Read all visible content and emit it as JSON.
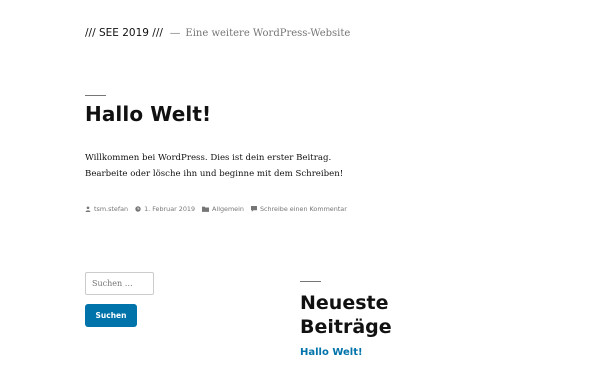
{
  "header": {
    "site_title": "/// SEE 2019 ///",
    "separator": "—",
    "tagline": "Eine weitere WordPress-Website"
  },
  "post": {
    "title": "Hallo Welt!",
    "content": [
      "Willkommen bei WordPress. Dies ist dein erster Beitrag.",
      "Bearbeite oder lösche ihn und beginne mit dem Schreiben!"
    ],
    "meta": {
      "author": "tsm.stefan",
      "date": "1. Februar 2019",
      "category": "Allgemein",
      "comment_link": "Schreibe einen Kommentar"
    }
  },
  "sidebar": {
    "search": {
      "placeholder": "Suchen …",
      "button_label": "Suchen"
    },
    "recent_posts": {
      "title": "Neueste Beiträge",
      "items": [
        "Hallo Welt!"
      ]
    }
  },
  "colors": {
    "accent": "#0073aa",
    "text": "#111111",
    "muted": "#767676"
  },
  "icons": [
    "person-icon",
    "clock-icon",
    "folder-icon",
    "comment-icon"
  ]
}
